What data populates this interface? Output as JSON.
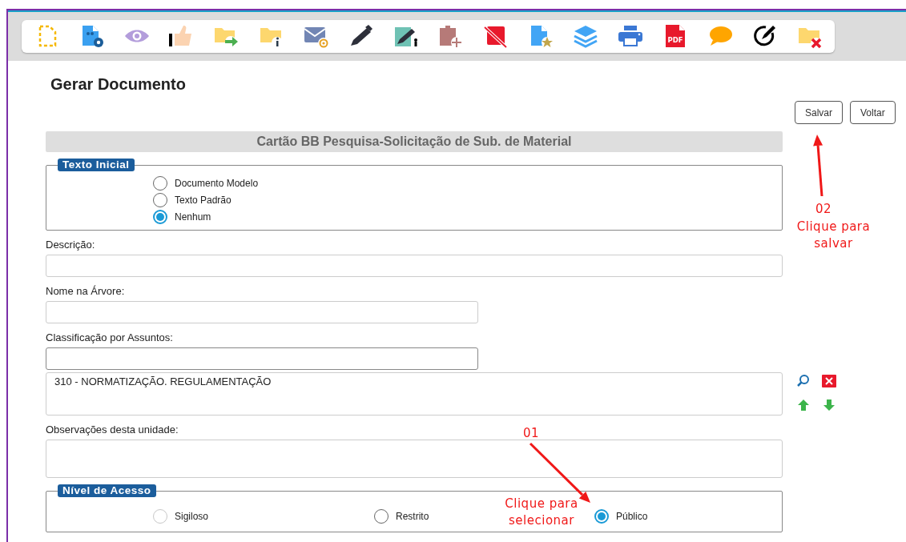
{
  "toolbar": {
    "pdf_icon_text": "PDF"
  },
  "page_title": "Gerar Documento",
  "buttons": [
    {
      "label": "Salvar"
    },
    {
      "label": "Voltar"
    }
  ],
  "document_type": "Cartão BB Pesquisa-Solicitação de Sub. de Material",
  "initial_text": {
    "legend": "Texto Inicial",
    "options": [
      {
        "label": "Documento Modelo",
        "selected": false
      },
      {
        "label": "Texto Padrão",
        "selected": false
      },
      {
        "label": "Nenhum",
        "selected": true
      }
    ]
  },
  "description": {
    "label": "Descrição:"
  },
  "tree_name": {
    "label": "Nome na Árvore:"
  },
  "subject_classification": {
    "label": "Classificação por Assuntos:",
    "items": [
      "310 - NORMATIZAÇÃO. REGULAMENTAÇÃO"
    ]
  },
  "observations": {
    "label": "Observações desta unidade:"
  },
  "access_level": {
    "legend": "Nível de Acesso",
    "options": [
      {
        "label": "Sigiloso",
        "selected": false,
        "disabled": true
      },
      {
        "label": "Restrito",
        "selected": false,
        "disabled": false
      },
      {
        "label": "Público",
        "selected": true,
        "disabled": false
      }
    ]
  },
  "annotations": [
    {
      "number": "01",
      "text": "Clique para selecionar"
    },
    {
      "number": "02",
      "text": "Clique para salvar"
    }
  ]
}
